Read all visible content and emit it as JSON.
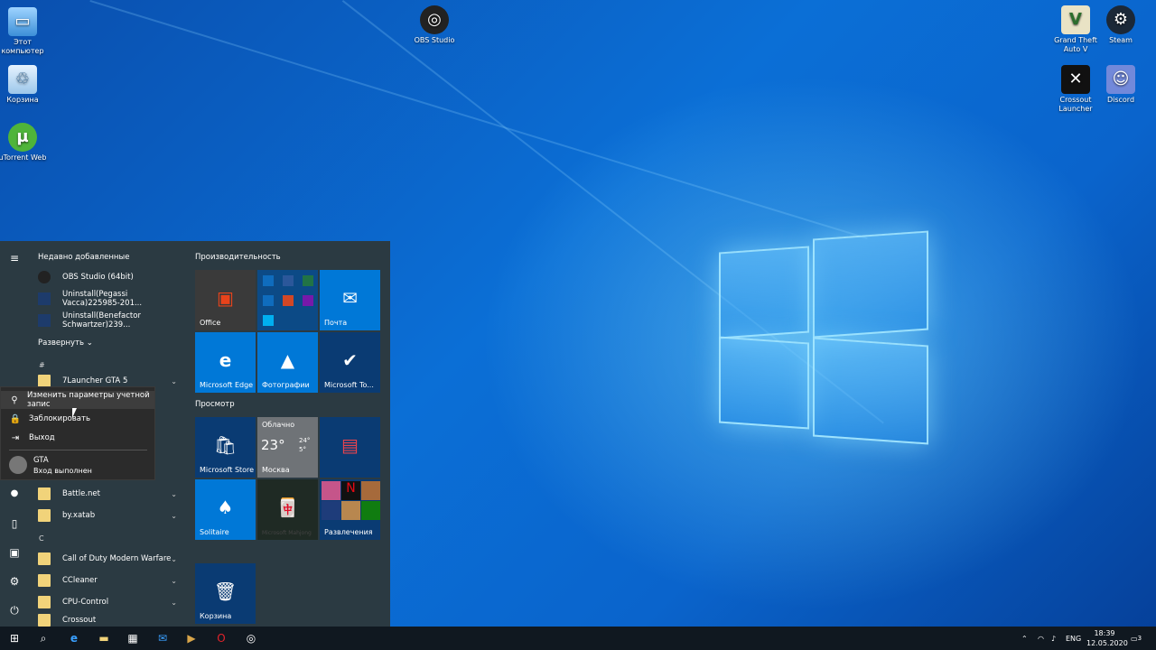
{
  "desktop": {
    "icons_left": [
      {
        "name": "this-pc-icon",
        "label": "Этот компьютер"
      },
      {
        "name": "recycle-bin-icon",
        "label": "Корзина"
      },
      {
        "name": "utorrent-icon",
        "label": "uTorrent Web"
      }
    ],
    "icons_center": [
      {
        "name": "obs-studio-icon",
        "label": "OBS Studio"
      }
    ],
    "icons_right": [
      {
        "name": "gta5-icon",
        "label": "Grand Theft Auto V"
      },
      {
        "name": "steam-icon",
        "label": "Steam"
      },
      {
        "name": "crossout-icon",
        "label": "Crossout Launcher"
      },
      {
        "name": "discord-icon",
        "label": "Discord"
      }
    ]
  },
  "start_menu": {
    "recent_title": "Недавно добавленные",
    "recent": [
      "OBS Studio (64bit)",
      "Uninstall(Pegassi Vacca)225985-201...",
      "Uninstall(Benefactor Schwartzer)239..."
    ],
    "expand_label": "Развернуть",
    "hash": "#",
    "app_7launcher": "7Launcher GTA 5",
    "apps_b": [
      "Battle.net",
      "by.xatab"
    ],
    "letter_c": "C",
    "apps_c": [
      "Call of Duty Modern Warfare",
      "CCleaner",
      "CPU-Control",
      "Crossout"
    ],
    "groups": {
      "productivity": "Производительность",
      "explore": "Просмотр"
    },
    "tiles": {
      "office": "Office",
      "mail": "Почта",
      "edge": "Microsoft Edge",
      "photos": "Фотографии",
      "todo": "Microsoft To...",
      "store": "Microsoft Store",
      "weather_cond": "Облачно",
      "weather_temp": "23°",
      "weather_hi": "24°",
      "weather_lo": "5°",
      "weather_city": "Москва",
      "solitaire": "Solitaire",
      "play": "Развлечения",
      "recycle": "Корзина",
      "mahjong": "Microsoft Mahjong"
    }
  },
  "account_popup": {
    "change_settings": "Изменить параметры учетной запис",
    "lock": "Заблокировать",
    "signout": "Выход",
    "user_name": "GTA",
    "user_status": "Вход выполнен"
  },
  "taskbar": {
    "lang": "ENG",
    "time": "18:39",
    "date": "12.05.2020",
    "notifications": "3"
  },
  "colors": {
    "accent": "#0078d7",
    "tile_blue": "#0063b1",
    "menu_bg": "#2b3a42"
  }
}
